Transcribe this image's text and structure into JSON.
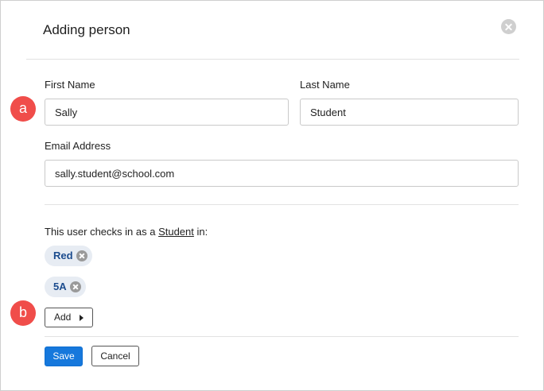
{
  "dialog": {
    "title": "Adding person",
    "close_icon": "close-icon"
  },
  "form": {
    "first_name": {
      "label": "First Name",
      "value": "Sally"
    },
    "last_name": {
      "label": "Last Name",
      "value": "Student"
    },
    "email": {
      "label": "Email Address",
      "value": "sally.student@school.com"
    }
  },
  "markers": {
    "a": "a",
    "b": "b"
  },
  "checkin": {
    "prefix": "This user checks in as a ",
    "role": "Student",
    "suffix": " in:",
    "groups": [
      {
        "label": "Red"
      },
      {
        "label": "5A"
      }
    ],
    "add_label": "Add"
  },
  "actions": {
    "save_label": "Save",
    "cancel_label": "Cancel"
  },
  "colors": {
    "primary": "#1678dc",
    "marker": "#f04d4a",
    "tag_bg": "#e7ecf3",
    "tag_text": "#1c4c8e"
  }
}
